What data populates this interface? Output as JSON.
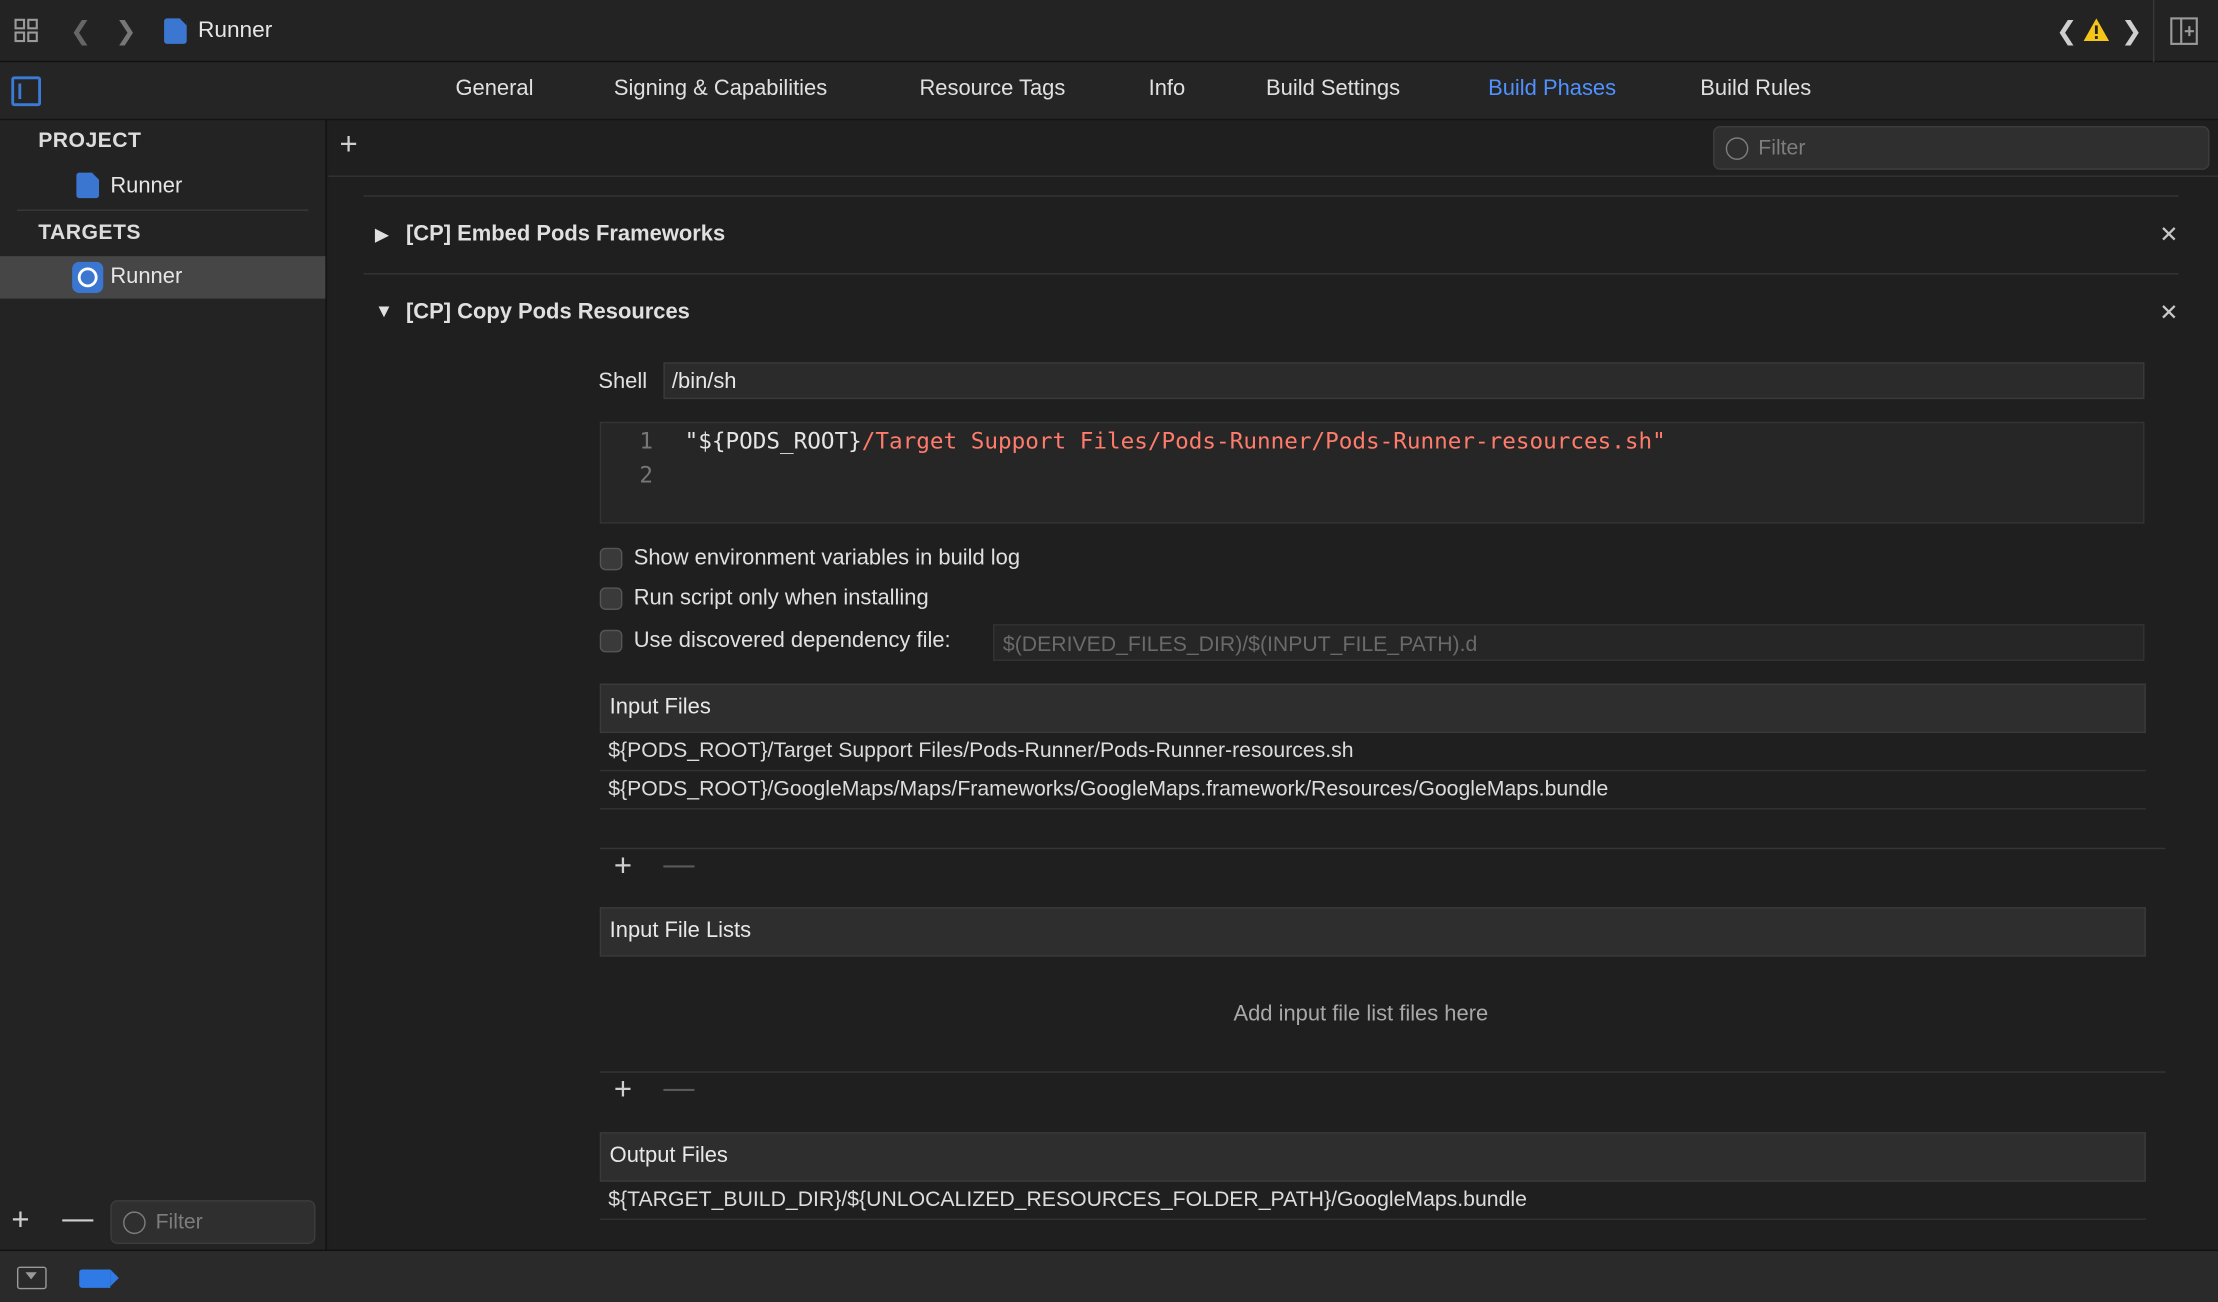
{
  "window": {
    "breadcrumb_title": "Runner"
  },
  "tabs": [
    {
      "label": "General"
    },
    {
      "label": "Signing & Capabilities"
    },
    {
      "label": "Resource Tags"
    },
    {
      "label": "Info"
    },
    {
      "label": "Build Settings"
    },
    {
      "label": "Build Phases",
      "active": true
    },
    {
      "label": "Build Rules"
    }
  ],
  "sidebar": {
    "project_header": "PROJECT",
    "project_item": "Runner",
    "targets_header": "TARGETS",
    "target_item": "Runner",
    "filter_placeholder": "Filter"
  },
  "main": {
    "filter_placeholder": "Filter",
    "phases": [
      {
        "title": "[CP] Embed Pods Frameworks",
        "expanded": false
      },
      {
        "title": "[CP] Copy Pods Resources",
        "expanded": true
      }
    ],
    "shell_label": "Shell",
    "shell_value": "/bin/sh",
    "script": {
      "line1_no": "1",
      "line2_no": "2",
      "line1_prefix": "\"${PODS_ROOT}",
      "line1_path": "/Target Support Files/Pods-Runner/Pods-Runner-resources.sh\""
    },
    "options": {
      "show_env": "Show environment variables in build log",
      "run_installing": "Run script only when installing",
      "use_dep_file": "Use discovered dependency file:",
      "dep_file_placeholder": "$(DERIVED_FILES_DIR)/$(INPUT_FILE_PATH).d"
    },
    "input_files": {
      "header": "Input Files",
      "rows": [
        "${PODS_ROOT}/Target Support Files/Pods-Runner/Pods-Runner-resources.sh",
        "${PODS_ROOT}/GoogleMaps/Maps/Frameworks/GoogleMaps.framework/Resources/GoogleMaps.bundle"
      ]
    },
    "input_file_lists": {
      "header": "Input File Lists",
      "empty_hint": "Add input file list files here"
    },
    "output_files": {
      "header": "Output Files",
      "rows": [
        "${TARGET_BUILD_DIR}/${UNLOCALIZED_RESOURCES_FOLDER_PATH}/GoogleMaps.bundle"
      ]
    }
  },
  "colors": {
    "accent": "#4f91ff",
    "script_path": "#ff7b6b",
    "warning": "#f5c518"
  }
}
